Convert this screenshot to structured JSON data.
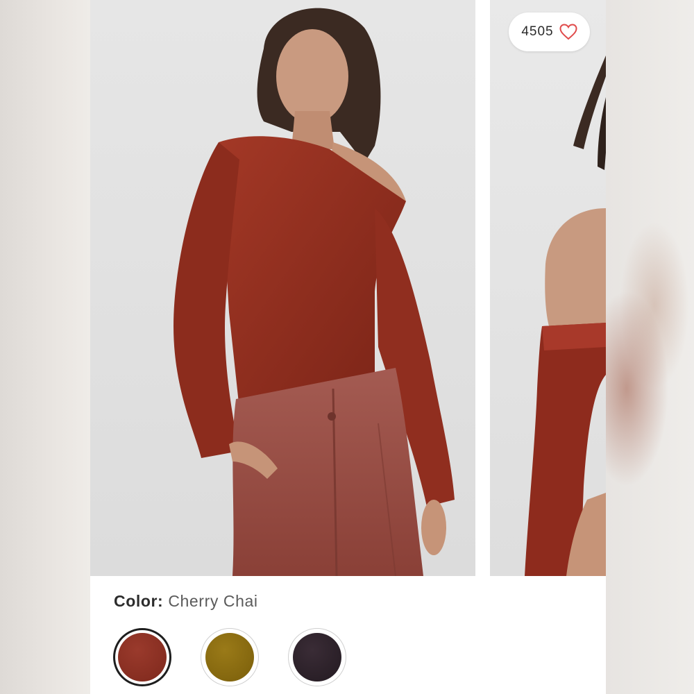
{
  "product": {
    "likes": "4505",
    "color_label": "Color:",
    "color_value": "Cherry Chai"
  },
  "gallery": {
    "images": [
      {
        "alt": "Model wearing one-shoulder long sleeve bodysuit, front view"
      },
      {
        "alt": "Model wearing one-shoulder bodysuit, side view"
      }
    ]
  },
  "swatches": [
    {
      "name": "Cherry Chai",
      "color": "#8a2f22",
      "selected": true
    },
    {
      "name": "Golden Olive",
      "color": "#8a6a0f",
      "selected": false
    },
    {
      "name": "Black Plum",
      "color": "#2a1f28",
      "selected": false
    }
  ],
  "icons": {
    "like": "heart-icon"
  },
  "colors": {
    "accent_heart": "#e04a4a",
    "text_primary": "#2c2c2c",
    "text_secondary": "#5a5a5a"
  }
}
